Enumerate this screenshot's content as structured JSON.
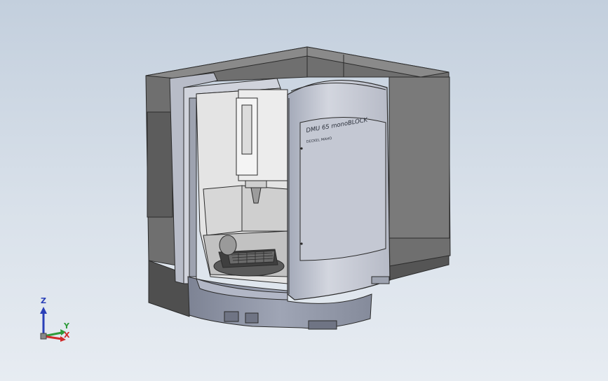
{
  "viewport": {
    "background_top": "#c3cfdd",
    "background_bottom": "#e7ecf2"
  },
  "model": {
    "name_label": "DMU 65 monoBLOCK",
    "subtitle_label": "DECKEL MAHO"
  },
  "triad": {
    "z_label": "Z",
    "y_label": "Y",
    "x_label": "X",
    "z_color": "#2a3fb8",
    "y_color": "#2e9b3a",
    "x_color": "#d02a2a"
  }
}
